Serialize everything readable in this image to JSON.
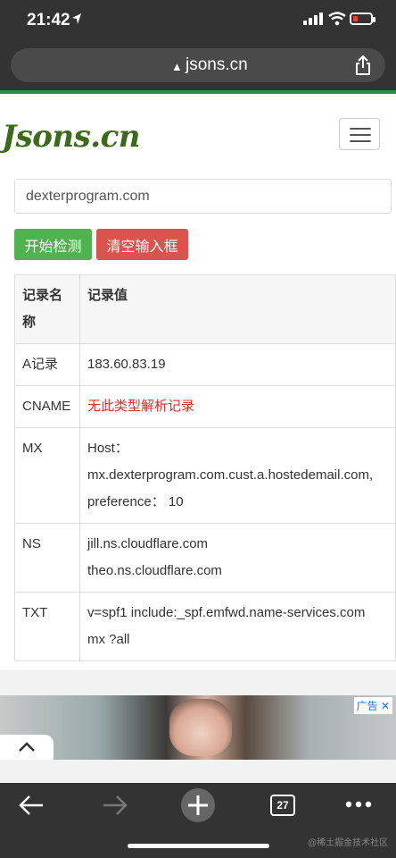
{
  "status": {
    "time": "21:42"
  },
  "browser": {
    "host": "jsons.cn",
    "tab_count": "27"
  },
  "site": {
    "logo": "Jsons.cn"
  },
  "form": {
    "input_value": "dexterprogram.com",
    "start_label": "开始检测",
    "clear_label": "清空输入框"
  },
  "table": {
    "header": {
      "name": "记录名称",
      "value": "记录值"
    },
    "rows": [
      {
        "name": "A记录",
        "lines": [
          "183.60.83.19"
        ]
      },
      {
        "name": "CNAME",
        "lines": [
          "无此类型解析记录"
        ]
      },
      {
        "name": "MX",
        "lines": [
          "Host：",
          "mx.dexterprogram.com.cust.a.hostedemail.com,",
          "preference： 10"
        ]
      },
      {
        "name": "NS",
        "lines": [
          "jill.ns.cloudflare.com",
          "theo.ns.cloudflare.com"
        ]
      },
      {
        "name": "TXT",
        "lines": [
          "v=spf1 include:_spf.emfwd.name-services.com",
          "mx ?all"
        ]
      }
    ]
  },
  "ad": {
    "tag": "广告"
  },
  "watermark": "@稀土掘金技术社区",
  "colors": {
    "accent_green": "#4fb34f",
    "danger_red": "#d9534f",
    "chrome_dark": "#333333"
  }
}
